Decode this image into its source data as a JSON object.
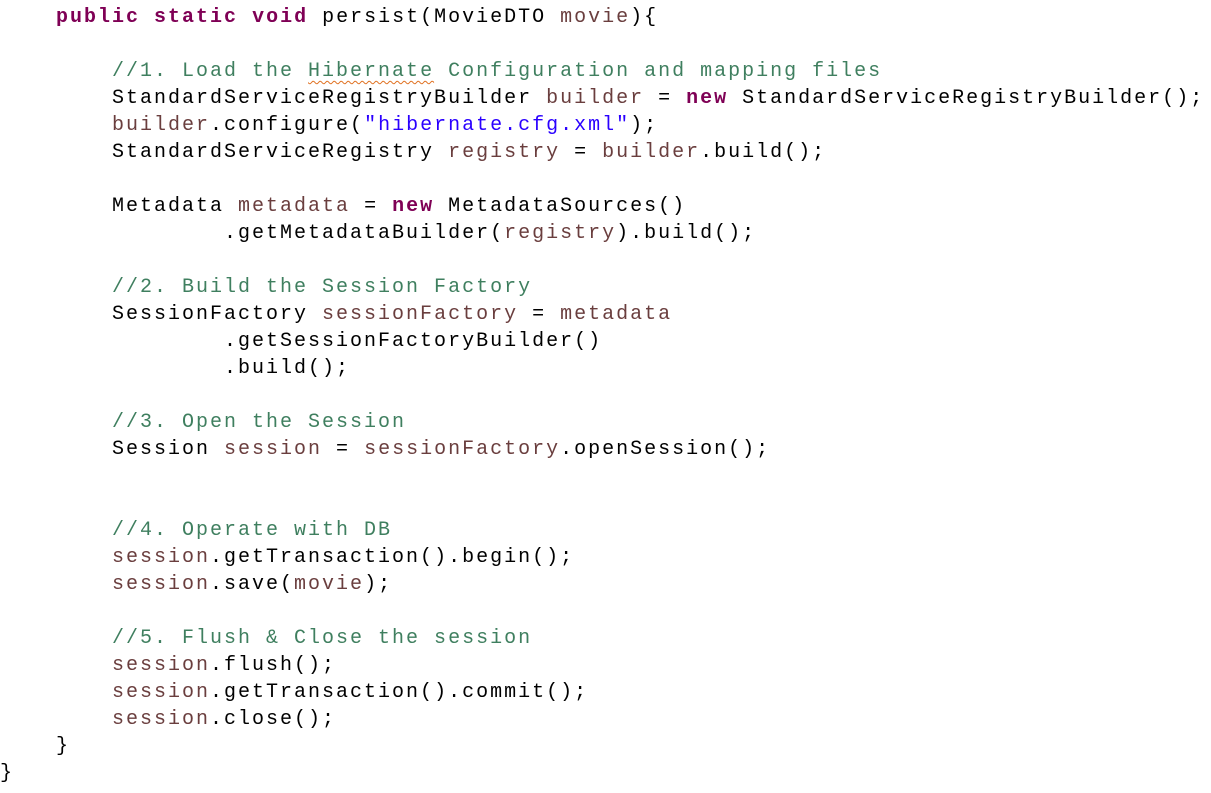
{
  "editor": {
    "colors": {
      "keyword": "#7F0055",
      "comment": "#3F7F5F",
      "variable": "#6A3E3E",
      "string": "#2A00FF",
      "default": "#000000"
    },
    "lines": [
      [
        [
          "    ",
          ""
        ],
        [
          "public",
          "kw"
        ],
        [
          " ",
          ""
        ],
        [
          "static",
          "kw"
        ],
        [
          " ",
          ""
        ],
        [
          "void",
          "kw"
        ],
        [
          " persist(MovieDTO ",
          ""
        ],
        [
          "movie",
          "var"
        ],
        [
          "){",
          ""
        ]
      ],
      [],
      [
        [
          "        ",
          ""
        ],
        [
          "//1. Load the ",
          "cm"
        ],
        [
          "Hibernate",
          "cm sq"
        ],
        [
          " Configuration and mapping files",
          "cm"
        ]
      ],
      [
        [
          "        StandardServiceRegistryBuilder ",
          ""
        ],
        [
          "builder",
          "var"
        ],
        [
          " = ",
          ""
        ],
        [
          "new",
          "kw"
        ],
        [
          " StandardServiceRegistryBuilder();",
          ""
        ]
      ],
      [
        [
          "        ",
          ""
        ],
        [
          "builder",
          "var"
        ],
        [
          ".configure(",
          ""
        ],
        [
          "\"hibernate.cfg.xml\"",
          "str"
        ],
        [
          ");",
          ""
        ]
      ],
      [
        [
          "        StandardServiceRegistry ",
          ""
        ],
        [
          "registry",
          "var"
        ],
        [
          " = ",
          ""
        ],
        [
          "builder",
          "var"
        ],
        [
          ".build();",
          ""
        ]
      ],
      [],
      [
        [
          "        Metadata ",
          ""
        ],
        [
          "metadata",
          "var"
        ],
        [
          " = ",
          ""
        ],
        [
          "new",
          "kw"
        ],
        [
          " MetadataSources()",
          ""
        ]
      ],
      [
        [
          "                .getMetadataBuilder(",
          ""
        ],
        [
          "registry",
          "var"
        ],
        [
          ").build();",
          ""
        ]
      ],
      [],
      [
        [
          "        ",
          ""
        ],
        [
          "//2. Build the Session Factory",
          "cm"
        ]
      ],
      [
        [
          "        SessionFactory ",
          ""
        ],
        [
          "sessionFactory",
          "var"
        ],
        [
          " = ",
          ""
        ],
        [
          "metadata",
          "var"
        ]
      ],
      [
        [
          "                .getSessionFactoryBuilder()",
          ""
        ]
      ],
      [
        [
          "                .build();",
          ""
        ]
      ],
      [],
      [
        [
          "        ",
          ""
        ],
        [
          "//3. Open the Session",
          "cm"
        ]
      ],
      [
        [
          "        Session ",
          ""
        ],
        [
          "session",
          "var"
        ],
        [
          " = ",
          ""
        ],
        [
          "sessionFactory",
          "var"
        ],
        [
          ".openSession();",
          ""
        ]
      ],
      [],
      [],
      [
        [
          "        ",
          ""
        ],
        [
          "//4. Operate with DB",
          "cm"
        ]
      ],
      [
        [
          "        ",
          ""
        ],
        [
          "session",
          "var"
        ],
        [
          ".getTransaction().begin();",
          ""
        ]
      ],
      [
        [
          "        ",
          ""
        ],
        [
          "session",
          "var"
        ],
        [
          ".save(",
          ""
        ],
        [
          "movie",
          "var"
        ],
        [
          ");",
          ""
        ]
      ],
      [],
      [
        [
          "        ",
          ""
        ],
        [
          "//5. Flush & Close the session",
          "cm"
        ]
      ],
      [
        [
          "        ",
          ""
        ],
        [
          "session",
          "var"
        ],
        [
          ".flush();",
          ""
        ]
      ],
      [
        [
          "        ",
          ""
        ],
        [
          "session",
          "var"
        ],
        [
          ".getTransaction().commit();",
          ""
        ]
      ],
      [
        [
          "        ",
          ""
        ],
        [
          "session",
          "var"
        ],
        [
          ".close();",
          ""
        ]
      ],
      [
        [
          "    }",
          ""
        ]
      ],
      [
        [
          "}",
          ""
        ]
      ]
    ]
  }
}
